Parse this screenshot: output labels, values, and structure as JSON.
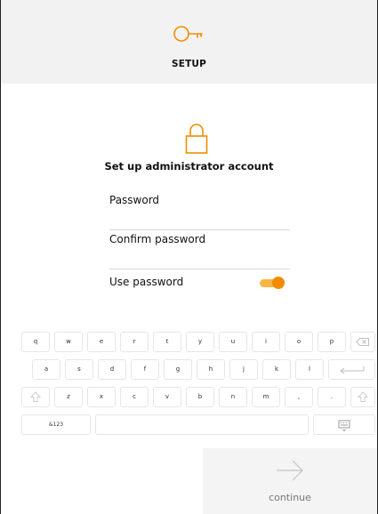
{
  "header": {
    "icon": "key-icon",
    "title": "SETUP"
  },
  "form": {
    "icon": "lock-icon",
    "title": "Set up administrator account",
    "password_label": "Password",
    "confirm_password_label": "Confirm password",
    "use_password_label": "Use password",
    "use_password_enabled": true
  },
  "keyboard": {
    "row1": [
      "q",
      "w",
      "e",
      "r",
      "t",
      "y",
      "u",
      "i",
      "o",
      "p"
    ],
    "row2": [
      "a",
      "s",
      "d",
      "f",
      "g",
      "h",
      "j",
      "k",
      "l"
    ],
    "row3": [
      "z",
      "x",
      "c",
      "v",
      "b",
      "n",
      "m",
      ",",
      "."
    ],
    "symbols_label": "&123",
    "backspace_icon": "backspace-icon",
    "enter_icon": "enter-icon",
    "shift_icon": "shift-icon",
    "keyboard_hide_icon": "keyboard-icon"
  },
  "footer": {
    "continue_icon": "arrow-right-icon",
    "continue_label": "continue"
  },
  "colors": {
    "accent": "#f28c00",
    "accent_light": "#f7b642",
    "header_bg": "#f2f2f2"
  }
}
